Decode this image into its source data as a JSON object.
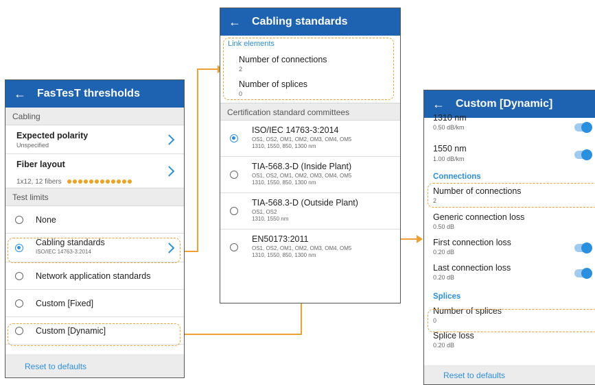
{
  "screen_left": {
    "title": "FasTesT thresholds",
    "cabling_section": "Cabling",
    "expected_polarity": {
      "label": "Expected polarity",
      "value": "Unspecified"
    },
    "fiber_layout": {
      "label": "Fiber layout",
      "value": "1x12, 12 fibers",
      "fiber_dot_count": 12
    },
    "test_limits_section": "Test limits",
    "options": [
      {
        "label": "None",
        "sub": "",
        "selected": false
      },
      {
        "label": "Cabling standards",
        "sub": "ISO/IEC 14763-3:2014",
        "selected": true
      },
      {
        "label": "Network application standards",
        "sub": "",
        "selected": false
      },
      {
        "label": "Custom [Fixed]",
        "sub": "",
        "selected": false
      },
      {
        "label": "Custom [Dynamic]",
        "sub": "",
        "selected": false
      }
    ],
    "reset": "Reset to defaults"
  },
  "screen_mid": {
    "title": "Cabling standards",
    "link_elements_head": "Link elements",
    "num_connections": {
      "label": "Number of connections",
      "value": "2"
    },
    "num_splices": {
      "label": "Number of splices",
      "value": "0"
    },
    "committees_section": "Certification standard committees",
    "standards": [
      {
        "name": "ISO/IEC 14763-3:2014",
        "fibers": "OS1, OS2, OM1, OM2, OM3, OM4, OM5",
        "wavelengths": "1310, 1550, 850, 1300 nm",
        "selected": true
      },
      {
        "name": "TIA-568.3-D (Inside Plant)",
        "fibers": "OS1, OS2, OM1, OM2, OM3, OM4, OM5",
        "wavelengths": "1310, 1550, 850, 1300 nm",
        "selected": false
      },
      {
        "name": "TIA-568.3-D (Outside Plant)",
        "fibers": "OS1, OS2",
        "wavelengths": "1310, 1550 nm",
        "selected": false
      },
      {
        "name": "EN50173:2011",
        "fibers": "OS1, OS2, OM1, OM2, OM3, OM4, OM5",
        "wavelengths": "1310, 1550, 850, 1300 nm",
        "selected": false
      }
    ]
  },
  "screen_right": {
    "title": "Custom [Dynamic]",
    "w1310": {
      "label": "1310 nm",
      "value": "0.50 dB/km",
      "enabled": true
    },
    "w1550": {
      "label": "1550 nm",
      "value": "1.00 dB/km",
      "enabled": true
    },
    "connections_head": "Connections",
    "num_connections": {
      "label": "Number of connections",
      "value": "2"
    },
    "generic_conn_loss": {
      "label": "Generic connection loss",
      "value": "0.50 dB"
    },
    "first_conn_loss": {
      "label": "First connection loss",
      "value": "0.20 dB",
      "enabled": true
    },
    "last_conn_loss": {
      "label": "Last connection loss",
      "value": "0.20 dB",
      "enabled": true
    },
    "splices_head": "Splices",
    "num_splices": {
      "label": "Number of splices",
      "value": "0"
    },
    "splice_loss": {
      "label": "Splice loss",
      "value": "0.20 dB"
    },
    "reset": "Reset to defaults"
  },
  "icons": {
    "back": "back-arrow-icon",
    "chevron": "chevron-right-icon",
    "radio": "radio-button-icon",
    "toggle": "toggle-switch-icon"
  },
  "colors": {
    "appbar": "#1e63b2",
    "accent": "#2b8fe0",
    "highlight": "#f0a030"
  }
}
